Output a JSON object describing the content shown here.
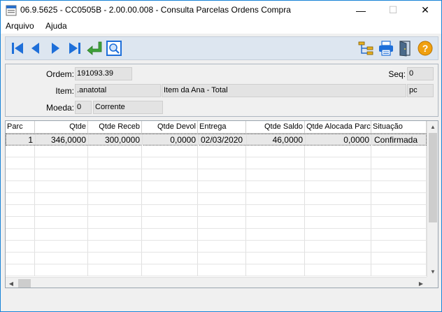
{
  "window": {
    "title": "06.9.5625 - CC0505B - 2.00.00.008 - Consulta Parcelas Ordens Compra",
    "minimize_glyph": "—",
    "maximize_glyph": "☐",
    "close_glyph": "✕"
  },
  "menu": {
    "items": [
      "Arquivo",
      "Ajuda"
    ]
  },
  "toolbar": {
    "icons": [
      "first-record-icon",
      "previous-record-icon",
      "next-record-icon",
      "last-record-icon",
      "return-icon",
      "zoom-icon",
      "tree-icon",
      "print-icon",
      "exit-icon",
      "help-icon"
    ],
    "help_glyph": "?"
  },
  "form": {
    "ordem_label": "Ordem:",
    "ordem_value": "191093.39",
    "seq_label": "Seq:",
    "seq_value": "0",
    "item_label": "Item:",
    "item_code": ".anatotal",
    "item_desc": "Item da Ana - Total",
    "item_unit": "pc",
    "moeda_label": "Moeda:",
    "moeda_code": "0",
    "moeda_desc": "Corrente"
  },
  "grid": {
    "headers": [
      "Parc",
      "Qtde",
      "Qtde Receb",
      "Qtde Devol",
      "Entrega",
      "Qtde Saldo",
      "Qtde Alocada Parc",
      "Situação"
    ],
    "rows": [
      [
        "1",
        "346,0000",
        "300,0000",
        "0,0000",
        "02/03/2020",
        "46,0000",
        "0,0000",
        "Confirmada"
      ]
    ]
  },
  "colors": {
    "titlebar_border": "#1883d7",
    "toolbar_bg": "#dde6f0",
    "nav_blue": "#1e6fd9",
    "return_green": "#3fa13a",
    "help_orange": "#f0a010"
  }
}
